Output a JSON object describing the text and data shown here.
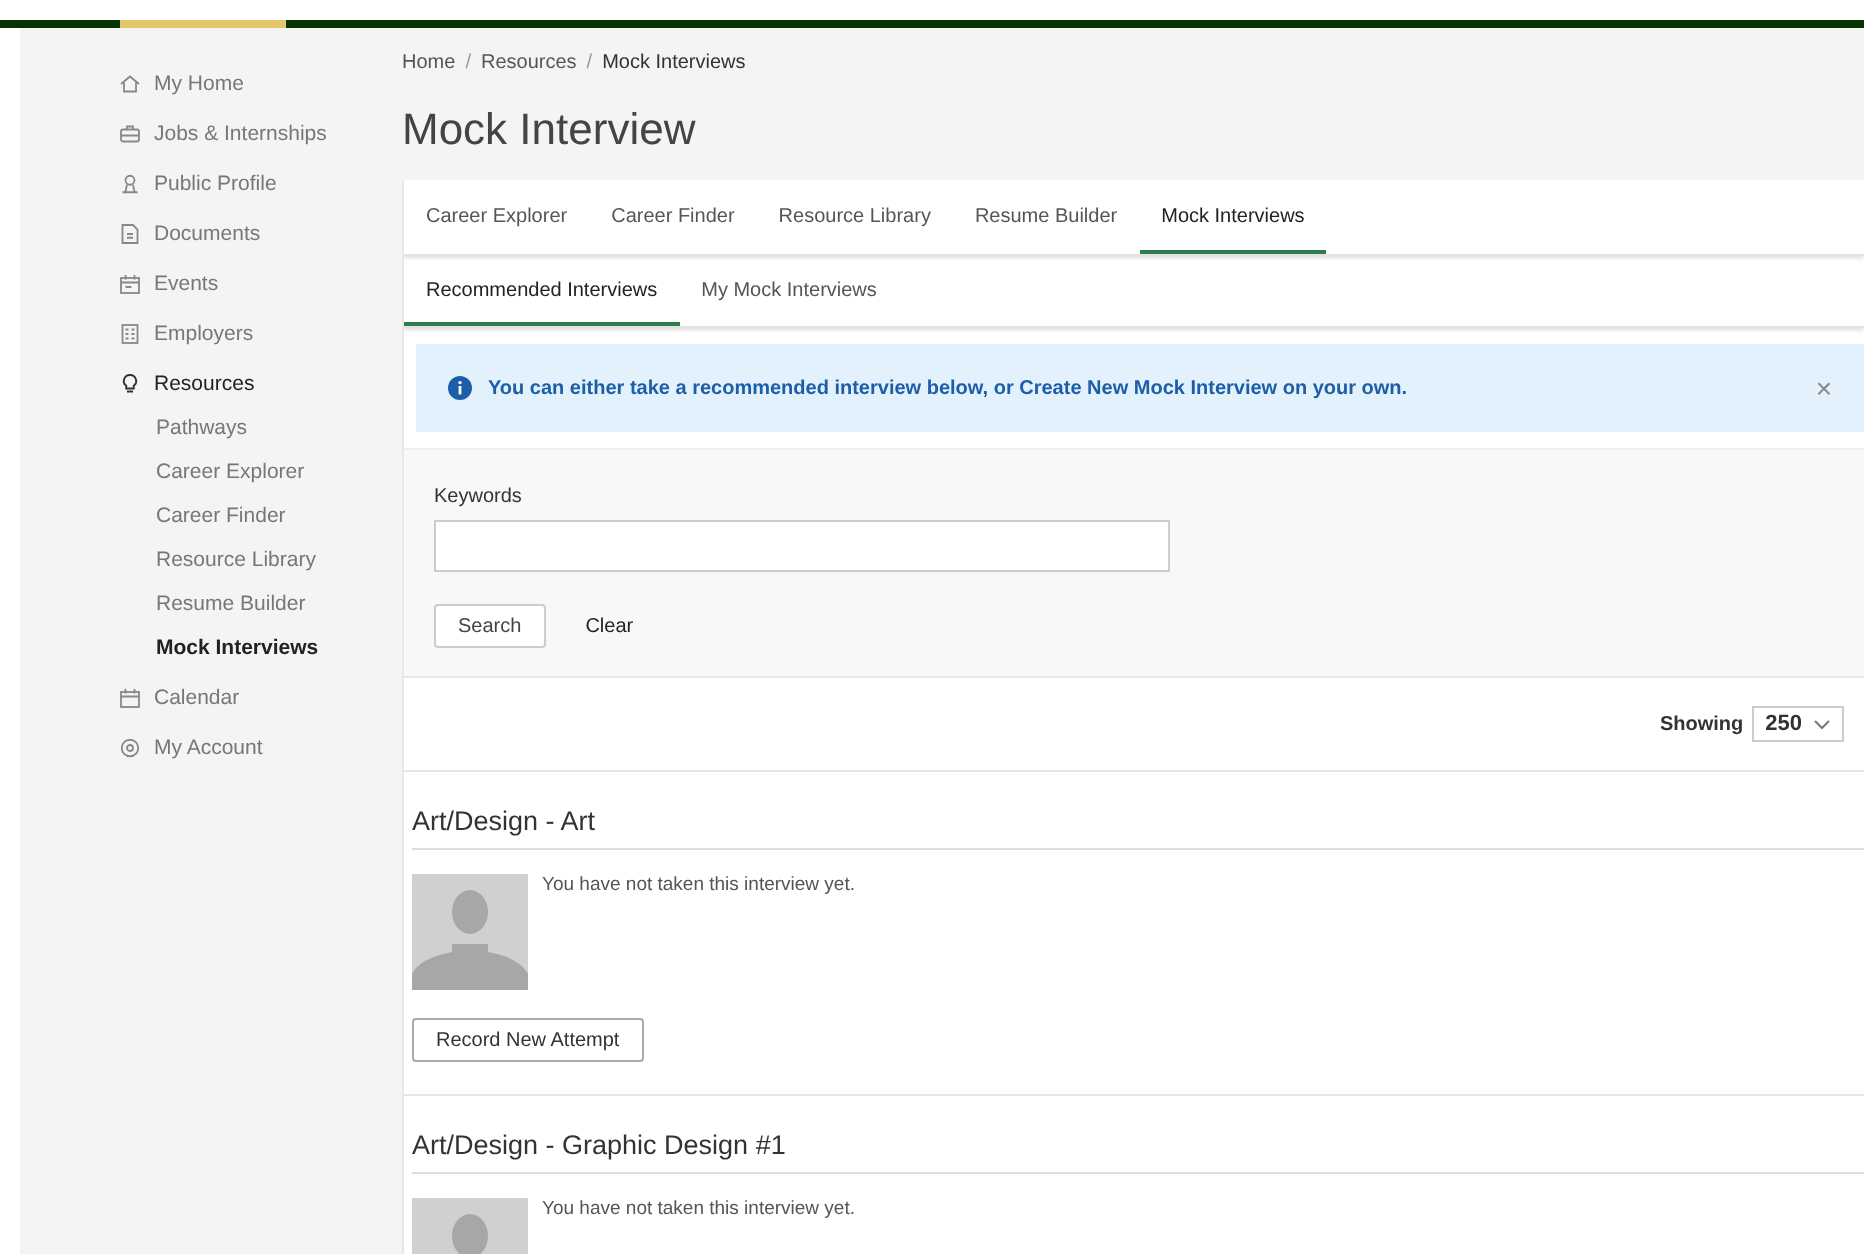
{
  "sidebar": {
    "items": [
      {
        "label": "My Home",
        "selected": false
      },
      {
        "label": "Jobs & Internships",
        "selected": false
      },
      {
        "label": "Public Profile",
        "selected": false
      },
      {
        "label": "Documents",
        "selected": false
      },
      {
        "label": "Events",
        "selected": false
      },
      {
        "label": "Employers",
        "selected": false
      },
      {
        "label": "Resources",
        "selected": true,
        "children": [
          {
            "label": "Pathways",
            "selected": false
          },
          {
            "label": "Career Explorer",
            "selected": false
          },
          {
            "label": "Career Finder",
            "selected": false
          },
          {
            "label": "Resource Library",
            "selected": false
          },
          {
            "label": "Resume Builder",
            "selected": false
          },
          {
            "label": "Mock Interviews",
            "selected": true
          }
        ]
      },
      {
        "label": "Calendar",
        "selected": false
      },
      {
        "label": "My Account",
        "selected": false
      }
    ]
  },
  "breadcrumb": [
    {
      "kind": "link",
      "text": "Home"
    },
    {
      "kind": "separator",
      "text": "/"
    },
    {
      "kind": "link",
      "text": "Resources"
    },
    {
      "kind": "separator",
      "text": "/"
    },
    {
      "kind": "current",
      "text": "Mock Interviews"
    }
  ],
  "page_title": "Mock Interview",
  "tabs": [
    {
      "label": "Career Explorer",
      "selected": false
    },
    {
      "label": "Career Finder",
      "selected": false
    },
    {
      "label": "Resource Library",
      "selected": false
    },
    {
      "label": "Resume Builder",
      "selected": false
    },
    {
      "label": "Mock Interviews",
      "selected": true
    }
  ],
  "subtabs": [
    {
      "label": "Recommended Interviews",
      "selected": true
    },
    {
      "label": "My Mock Interviews",
      "selected": false
    }
  ],
  "alert": {
    "message": "You can either take a recommended interview below, or Create New Mock Interview on your own.",
    "close": "×"
  },
  "search": {
    "label": "Keywords",
    "search_button": "Search",
    "clear_button": "Clear"
  },
  "showing": {
    "label": "Showing",
    "value": "250"
  },
  "interviews": [
    {
      "title": "Art/Design - Art",
      "status": "You have not taken this interview yet.",
      "button": "Record New Attempt"
    },
    {
      "title": "Art/Design - Graphic Design #1",
      "status": "You have not taken this interview yet."
    }
  ]
}
